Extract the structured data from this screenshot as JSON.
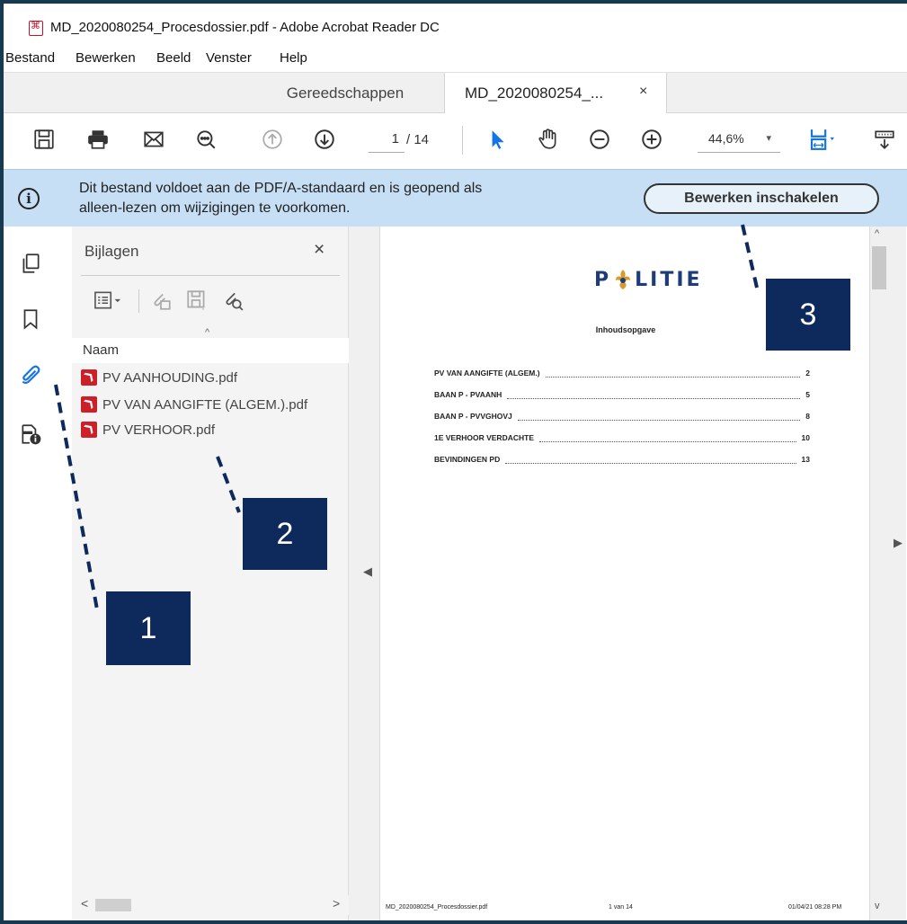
{
  "window": {
    "title": "MD_2020080254_Procesdossier.pdf - Adobe Acrobat Reader DC"
  },
  "menu": [
    "Bestand",
    "Bewerken",
    "Beeld",
    "Venster",
    "Help"
  ],
  "tabs": {
    "tools_label": "Gereedschappen",
    "doc_label": "MD_2020080254_...",
    "close_glyph": "×"
  },
  "toolbar": {
    "page_current": "1",
    "page_total": "/ 14",
    "zoom": "44,6%",
    "zoom_caret": "▾"
  },
  "notice": {
    "info_glyph": "i",
    "line1": "Dit bestand voldoet aan de PDF/A-standaard en is geopend als",
    "line2": "alleen-lezen om wijzigingen te voorkomen.",
    "button": "Bewerken inschakelen"
  },
  "attachments_panel": {
    "title": "Bijlagen",
    "close_glyph": "×",
    "sort_glyph": "^",
    "column_header": "Naam",
    "files": [
      "PV AANHOUDING.pdf",
      "PV VAN AANGIFTE (ALGEM.).pdf",
      "PV VERHOOR.pdf"
    ],
    "scroll_left": "<",
    "scroll_right": ">"
  },
  "document": {
    "logo_pre": "P",
    "logo_post": "LITIE",
    "toc_title": "Inhoudsopgave",
    "toc": [
      {
        "label": "PV VAN AANGIFTE (ALGEM.)",
        "page": "2"
      },
      {
        "label": "BAAN P - PVAANH",
        "page": "5"
      },
      {
        "label": "BAAN P - PVVGHOVJ",
        "page": "8"
      },
      {
        "label": "1E VERHOOR VERDACHTE",
        "page": "10"
      },
      {
        "label": "BEVINDINGEN PD",
        "page": "13"
      }
    ],
    "footer_left": "MD_2020080254_Procesdossier.pdf",
    "footer_center": "1 van 14",
    "footer_right": "01/04/21 08:28 PM"
  },
  "scroll_glyphs": {
    "up": "^",
    "down": "v",
    "left": "◀",
    "right": "▶"
  },
  "callouts": [
    "1",
    "2",
    "3"
  ],
  "colors": {
    "accent": "#1473e6",
    "callout": "#0e2a5c",
    "notice": "#c6dff4",
    "pdf_red": "#cc1f27"
  },
  "icons": [
    "save-icon",
    "print-icon",
    "mail-icon",
    "search-zoom-icon",
    "page-up-icon",
    "page-down-icon",
    "select-cursor-icon",
    "hand-tool-icon",
    "zoom-out-icon",
    "zoom-in-icon",
    "page-fit-icon",
    "more-tools-icon",
    "page-thumbnails-icon",
    "bookmark-icon",
    "attachment-icon",
    "document-info-icon",
    "options-icon",
    "attach-file-icon",
    "save-attachment-icon",
    "search-attachment-icon"
  ]
}
